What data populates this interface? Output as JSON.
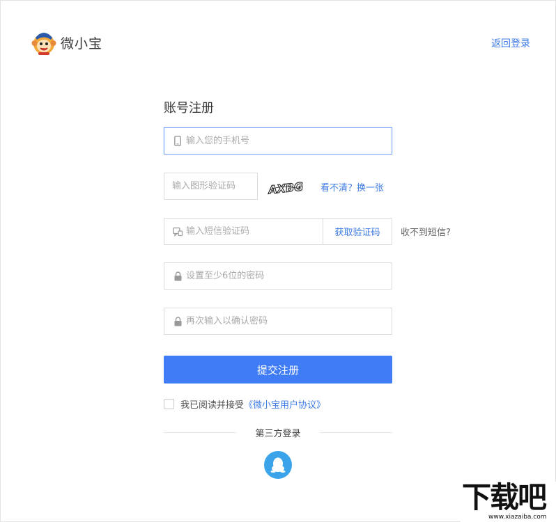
{
  "header": {
    "brand_name": "微小宝",
    "back_link": "返回登录"
  },
  "form": {
    "title": "账号注册",
    "phone_placeholder": "输入您的手机号",
    "captcha_placeholder": "输入图形验证码",
    "captcha_image_text": "AXBG",
    "captcha_refresh": "看不清？换一张",
    "sms_placeholder": "输入短信验证码",
    "sms_button": "获取验证码",
    "no_sms": "收不到短信?",
    "password_placeholder": "设置至少6位的密码",
    "confirm_password_placeholder": "再次输入以确认密码",
    "submit": "提交注册",
    "agree_text": "我已阅读并接受",
    "agreement_link": "《微小宝用户协议》",
    "third_party_label": "第三方登录"
  },
  "icons": {
    "phone": "mobile-phone-icon",
    "sms": "message-icon",
    "password": "lock-icon",
    "qq": "qq-penguin-icon"
  },
  "colors": {
    "accent": "#3f7cf6",
    "link": "#3d7be5",
    "qq": "#3aa3e9"
  },
  "watermark": {
    "text": "下载吧",
    "url": "www.xiazaiba.com"
  }
}
